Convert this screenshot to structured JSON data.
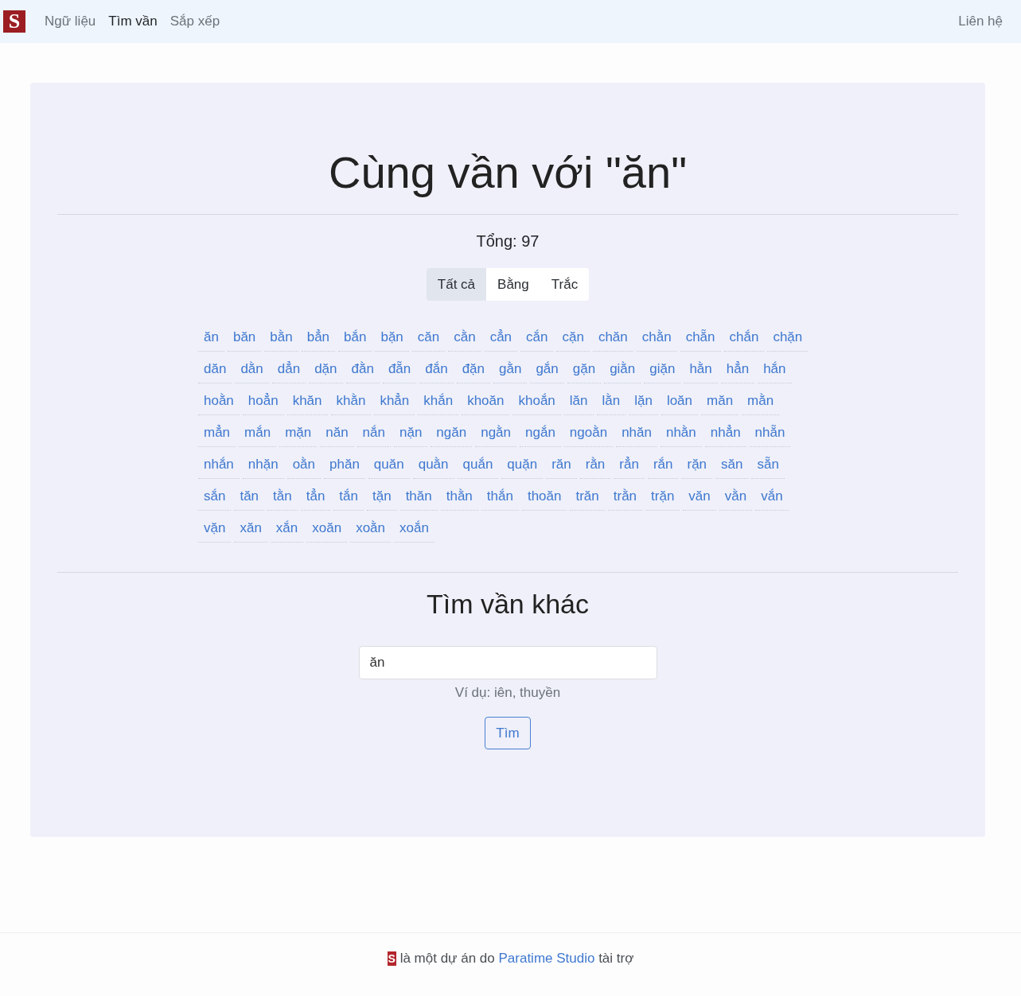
{
  "navbar": {
    "logo": "S",
    "links": [
      {
        "label": "Ngữ liệu",
        "selected": false
      },
      {
        "label": "Tìm vần",
        "selected": true
      },
      {
        "label": "Sắp xếp",
        "selected": false
      }
    ],
    "contact_link": "Liên hệ"
  },
  "results": {
    "title": "Cùng vần với \"ăn\"",
    "total": "Tổng: 97",
    "filter_tabs": [
      {
        "label": "Tất cả",
        "selected": true
      },
      {
        "label": "Bằng",
        "selected": false
      },
      {
        "label": "Trắc",
        "selected": false
      }
    ],
    "words": [
      "ăn",
      "băn",
      "bằn",
      "bẳn",
      "bắn",
      "bặn",
      "căn",
      "cằn",
      "cẳn",
      "cắn",
      "cặn",
      "chăn",
      "chằn",
      "chẵn",
      "chắn",
      "chặn",
      "dăn",
      "dằn",
      "dẳn",
      "dặn",
      "đằn",
      "đẵn",
      "đắn",
      "đặn",
      "gằn",
      "gắn",
      "gặn",
      "giằn",
      "giặn",
      "hằn",
      "hẳn",
      "hắn",
      "hoằn",
      "hoẳn",
      "khăn",
      "khằn",
      "khẳn",
      "khắn",
      "khoăn",
      "khoắn",
      "lăn",
      "lằn",
      "lặn",
      "loăn",
      "măn",
      "mằn",
      "mẳn",
      "mắn",
      "mặn",
      "năn",
      "nắn",
      "nặn",
      "ngăn",
      "ngằn",
      "ngắn",
      "ngoằn",
      "nhăn",
      "nhằn",
      "nhẳn",
      "nhẵn",
      "nhắn",
      "nhặn",
      "oằn",
      "phăn",
      "quăn",
      "quằn",
      "quắn",
      "quặn",
      "răn",
      "rằn",
      "rẳn",
      "rắn",
      "rặn",
      "săn",
      "sẵn",
      "sắn",
      "tăn",
      "tằn",
      "tẳn",
      "tắn",
      "tặn",
      "thăn",
      "thằn",
      "thắn",
      "thoăn",
      "trăn",
      "trằn",
      "trặn",
      "văn",
      "vằn",
      "vắn",
      "vặn",
      "xăn",
      "xắn",
      "xoăn",
      "xoằn",
      "xoắn"
    ]
  },
  "search": {
    "heading": "Tìm vần khác",
    "value": "ăn",
    "help_text": "Ví dụ: iên, thuyền",
    "button": "Tìm"
  },
  "footer": {
    "logo": "S",
    "text_before": "là một dự án do",
    "link": "Paratime Studio",
    "text_after": "tài trợ"
  }
}
